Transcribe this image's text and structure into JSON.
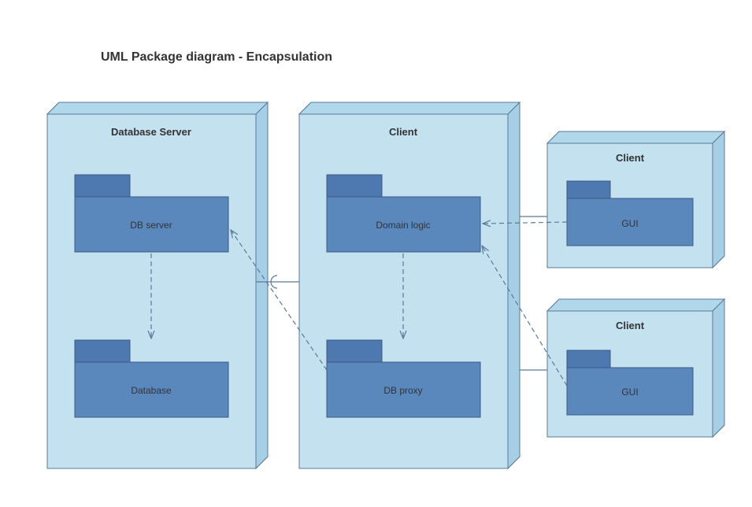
{
  "title": "UML Package diagram - Encapsulation",
  "nodes": {
    "dbServer": {
      "label": "Database Server"
    },
    "client": {
      "label": "Client"
    },
    "clientBox1": {
      "label": "Client"
    },
    "clientBox2": {
      "label": "Client"
    }
  },
  "packages": {
    "dbServerPkg": {
      "label": "DB server"
    },
    "databasePkg": {
      "label": "Database"
    },
    "domainLogicPkg": {
      "label": "Domain logic"
    },
    "dbProxyPkg": {
      "label": "DB proxy"
    },
    "gui1": {
      "label": "GUI"
    },
    "gui2": {
      "label": "GUI"
    }
  }
}
